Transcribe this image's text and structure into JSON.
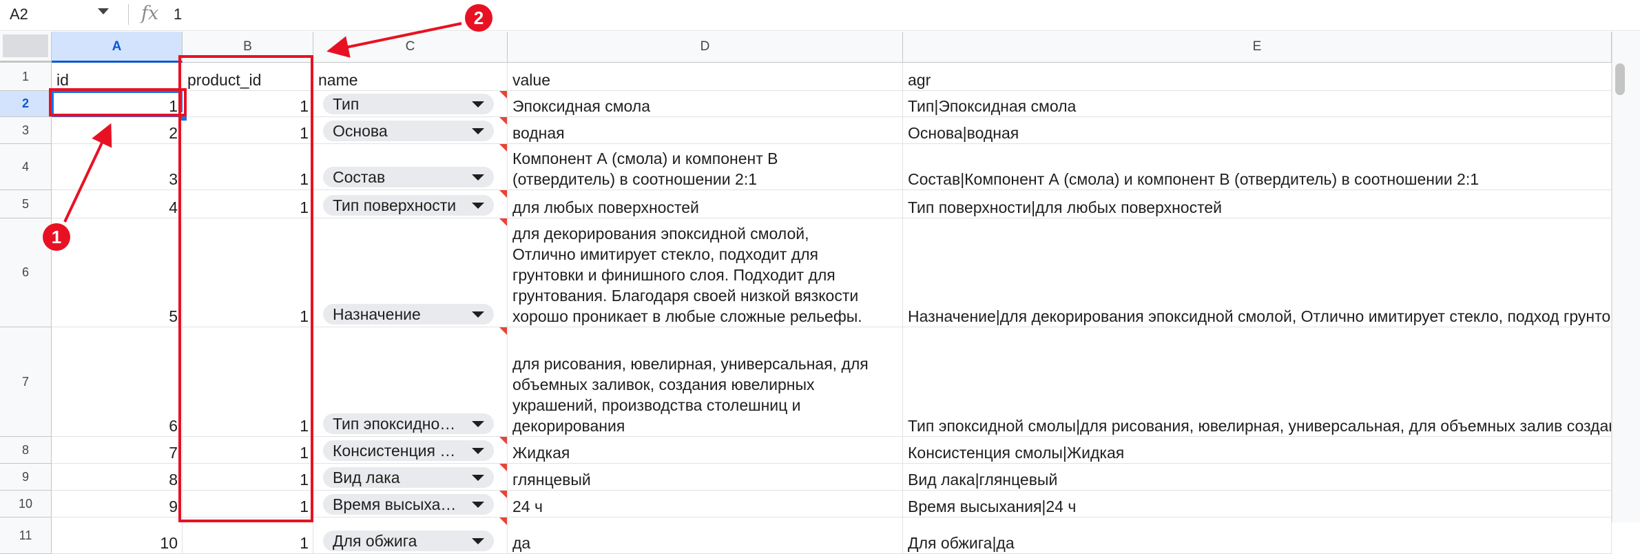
{
  "formula_bar": {
    "name_box": "A2",
    "fx_label": "fx",
    "value": "1"
  },
  "columns": [
    "A",
    "B",
    "C",
    "D",
    "E"
  ],
  "rows": [
    {
      "num": "1",
      "id": "id",
      "product_id": "product_id",
      "name": "name",
      "value": "value",
      "agr": "agr"
    },
    {
      "num": "2",
      "id": "1",
      "product_id": "1",
      "name": "Тип",
      "value": "Эпоксидная смола",
      "agr": "Тип|Эпоксидная смола"
    },
    {
      "num": "3",
      "id": "2",
      "product_id": "1",
      "name": "Основа",
      "value": "водная",
      "agr": "Основа|водная"
    },
    {
      "num": "4",
      "id": "3",
      "product_id": "1",
      "name": "Состав",
      "value": "Компонент А (смола) и компонент В\n(отвердитель) в соотношении 2:1",
      "agr": "Состав|Компонент А (смола) и компонент В (отвердитель) в соотношении 2:1"
    },
    {
      "num": "5",
      "id": "4",
      "product_id": "1",
      "name": "Тип поверхности",
      "value": "для любых поверхностей",
      "agr": "Тип поверхности|для любых поверхностей"
    },
    {
      "num": "6",
      "id": "5",
      "product_id": "1",
      "name": "Назначение",
      "value": "для декорирования эпоксидной смолой,\nОтлично имитирует стекло, подходит для\nгрунтовки и финишного слоя. Подходит для\nгрунтования. Благодаря своей низкой вязкости\nхорошо проникает в любые сложные рельефы.",
      "agr": "Назначение|для декорирования эпоксидной смолой, Отлично имитирует стекло, подход\nгрунтовки и финишного слоя. Подходит для грунтования. Благодаря своей низкой вязкос\nхорошо проникает в любые сложные рельефы."
    },
    {
      "num": "7",
      "id": "6",
      "product_id": "1",
      "name": "Тип эпоксидно…",
      "value": "для рисования, ювелирная, универсальная, для\nобъемных заливок, создания ювелирных\nукрашений, производства столешниц и\nдекорирования",
      "agr": "Тип эпоксидной смолы|для рисования, ювелирная, универсальная, для объемных залив\nсоздания ювелирных украшений, производства столешниц и декорирования"
    },
    {
      "num": "8",
      "id": "7",
      "product_id": "1",
      "name": "Консистенция …",
      "value": "Жидкая",
      "agr": "Консистенция смолы|Жидкая"
    },
    {
      "num": "9",
      "id": "8",
      "product_id": "1",
      "name": "Вид лака",
      "value": "глянцевый",
      "agr": "Вид лака|глянцевый"
    },
    {
      "num": "10",
      "id": "9",
      "product_id": "1",
      "name": "Время высыха…",
      "value": "24 ч",
      "agr": "Время высыхания|24 ч"
    },
    {
      "num": "11",
      "id": "10",
      "product_id": "1",
      "name": "Для обжига",
      "value": "да",
      "agr": "Для обжига|да"
    }
  ],
  "annotations": {
    "badge_1": "1",
    "badge_2": "2",
    "color": "#e81123"
  },
  "colors": {
    "active_header": "#d3e3fd",
    "selection": "#1a73e8",
    "chip": "#e8eaed"
  }
}
